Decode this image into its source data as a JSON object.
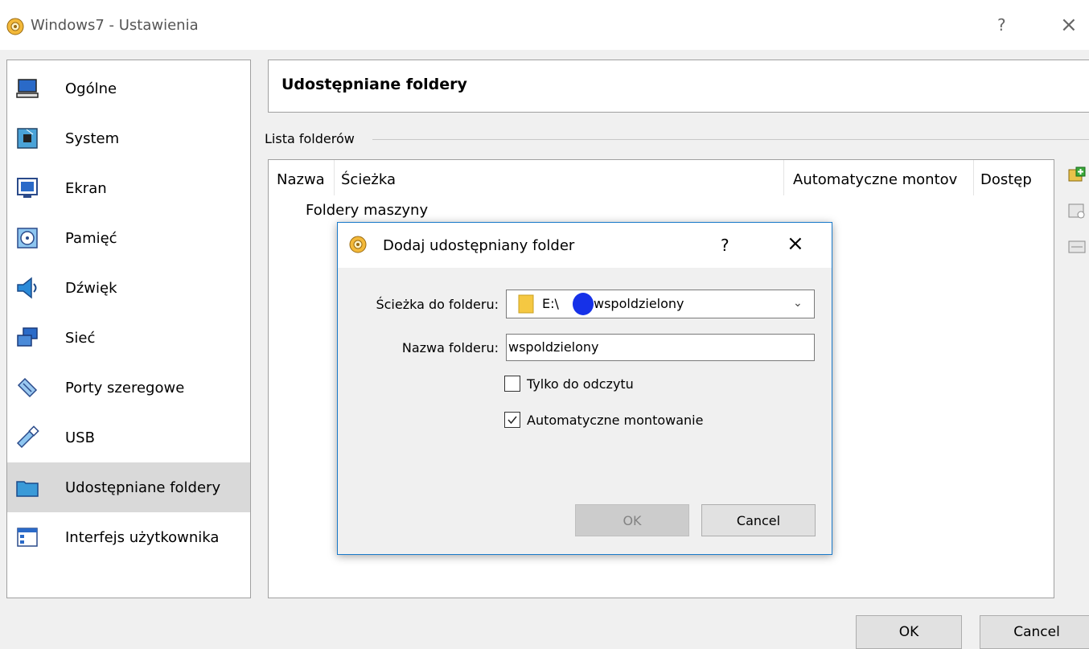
{
  "window": {
    "title": "Windows7 - Ustawienia",
    "help": "?",
    "close": "×"
  },
  "sidebar": {
    "items": [
      {
        "label": "Ogólne",
        "icon": "monitor-icon",
        "selected": false
      },
      {
        "label": "System",
        "icon": "chip-icon",
        "selected": false
      },
      {
        "label": "Ekran",
        "icon": "display-icon",
        "selected": false
      },
      {
        "label": "Pamięć",
        "icon": "disk-icon",
        "selected": false
      },
      {
        "label": "Dźwięk",
        "icon": "speaker-icon",
        "selected": false
      },
      {
        "label": "Sieć",
        "icon": "network-icon",
        "selected": false
      },
      {
        "label": "Porty szeregowe",
        "icon": "serial-port-icon",
        "selected": false
      },
      {
        "label": "USB",
        "icon": "usb-icon",
        "selected": false
      },
      {
        "label": "Udostępniane foldery",
        "icon": "folder-icon",
        "selected": true
      },
      {
        "label": "Interfejs użytkownika",
        "icon": "user-interface-icon",
        "selected": false
      }
    ]
  },
  "main": {
    "title": "Udostępniane foldery",
    "group_label": "Lista folderów",
    "columns": [
      "Nazwa",
      "Ścieżka",
      "Automatyczne montov",
      "Dostęp"
    ],
    "tree_root": "Foldery maszyny",
    "tools": [
      "add-folder-icon",
      "edit-folder-icon",
      "remove-folder-icon"
    ]
  },
  "footer": {
    "ok": "OK",
    "cancel": "Cancel"
  },
  "dialog": {
    "title": "Dodaj udostępniany folder",
    "help": "?",
    "close": "×",
    "path_label": "Ścieżka do folderu:",
    "path_prefix": "E:\\",
    "path_suffix": "wspoldzielony",
    "name_label": "Nazwa folderu:",
    "name_value": "wspoldzielony",
    "readonly_label": "Tylko do odczytu",
    "readonly_checked": false,
    "automount_label": "Automatyczne montowanie",
    "automount_checked": true,
    "ok": "OK",
    "cancel": "Cancel"
  },
  "colors": {
    "accent": "#1979ca",
    "selected_bg": "#d9d9d9",
    "redaction": "#1631e8"
  }
}
